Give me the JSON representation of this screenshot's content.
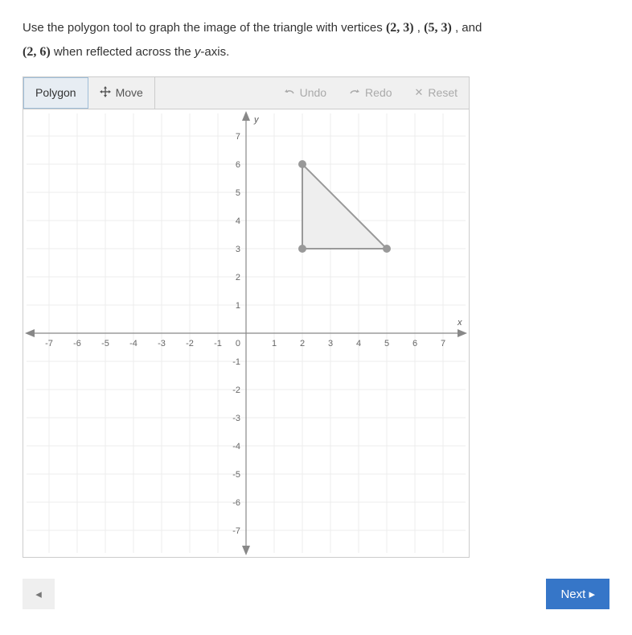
{
  "prompt": {
    "line1_a": "Use the polygon tool to graph the image of the triangle with vertices ",
    "v1": "(2,  3)",
    "sep1": " , ",
    "v2": "(5,  3)",
    "sep2": " , and ",
    "v3": "(2,  6)",
    "line2_a": " when reflected across the ",
    "line2_var": "y",
    "line2_b": "-axis."
  },
  "toolbar": {
    "polygon": "Polygon",
    "move": "Move",
    "undo": "Undo",
    "redo": "Redo",
    "reset": "Reset"
  },
  "footer": {
    "prev": "◂",
    "next": "Next ▸"
  },
  "chart_data": {
    "type": "scatter",
    "title": "",
    "xlabel": "x",
    "ylabel": "y",
    "xlim": [
      -7.5,
      7.5
    ],
    "ylim": [
      -7.5,
      7.5
    ],
    "xticks": [
      -7,
      -6,
      -5,
      -4,
      -3,
      -2,
      -1,
      0,
      1,
      2,
      3,
      4,
      5,
      6,
      7
    ],
    "yticks": [
      -7,
      -6,
      -5,
      -4,
      -3,
      -2,
      -1,
      1,
      2,
      3,
      4,
      5,
      6,
      7
    ],
    "grid": true,
    "triangle_vertices": [
      {
        "x": 2,
        "y": 3
      },
      {
        "x": 5,
        "y": 3
      },
      {
        "x": 2,
        "y": 6
      }
    ]
  }
}
